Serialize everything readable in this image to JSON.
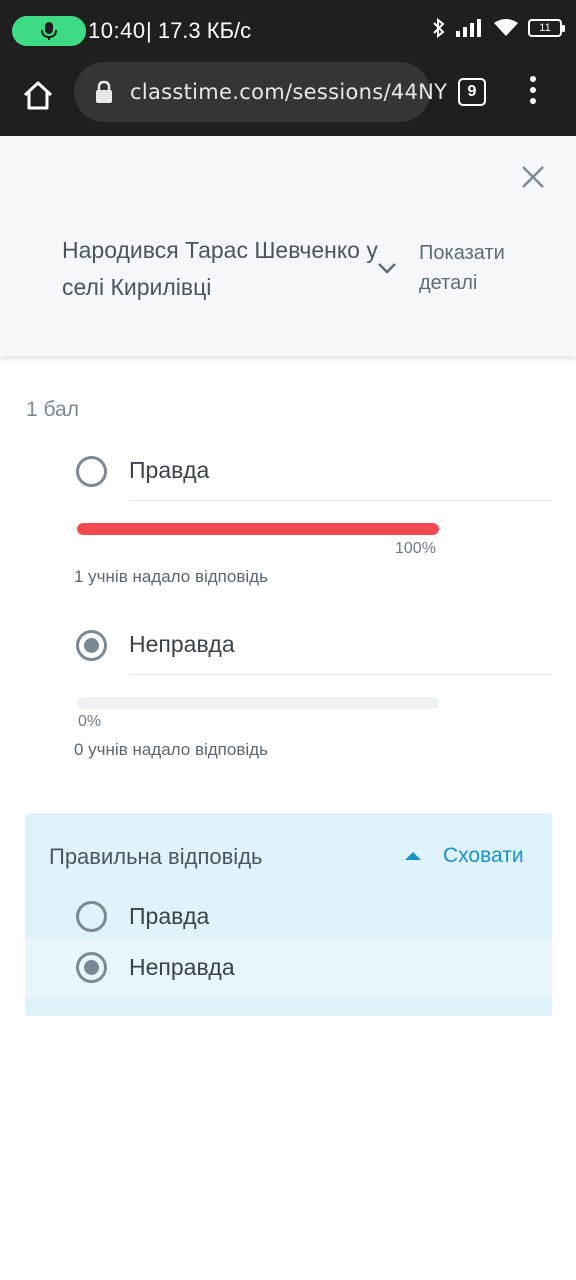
{
  "status_bar": {
    "time": "10:40",
    "speed": "| 17.3 КБ/с",
    "battery": "11",
    "icons": [
      "microphone-icon",
      "bluetooth-icon",
      "signal-icon",
      "wifi-icon",
      "battery-icon"
    ]
  },
  "browser": {
    "url": "classtime.com/sessions/44NY",
    "tab_count": "9"
  },
  "header": {
    "question": "Народився Тарас Шевченко у селі Кирилівці",
    "details_link": "Показати деталі"
  },
  "points": "1 бал",
  "options": [
    {
      "label": "Правда",
      "checked": false,
      "percent_label": "100%",
      "percent": 100,
      "responses": "1 учнів надало відповідь"
    },
    {
      "label": "Неправда",
      "checked": true,
      "percent_label": "0%",
      "percent": 0,
      "responses": "0 учнів надало відповідь"
    }
  ],
  "correct_answer": {
    "title": "Правильна відповідь",
    "hide_label": "Сховати",
    "options": [
      {
        "label": "Правда",
        "checked": false
      },
      {
        "label": "Неправда",
        "checked": true
      }
    ]
  },
  "colors": {
    "accent": "#1992c8",
    "bar_fill": "#f0494f",
    "panel_bg": "#e0f3fb"
  }
}
